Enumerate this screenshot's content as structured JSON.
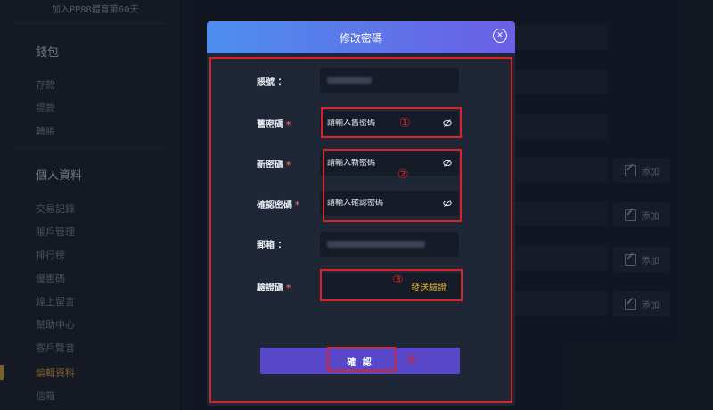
{
  "sidebar": {
    "top_text": "加入PP88體育第60天",
    "wallet_heading": "錢包",
    "wallet_items": [
      "存款",
      "提款",
      "轉賬"
    ],
    "profile_heading": "個人資料",
    "profile_items": [
      "交易記錄",
      "賬戶管理",
      "排行榜",
      "優惠碼",
      "線上留言",
      "幫助中心",
      "客戶聲音",
      "編輯資料",
      "信箱"
    ],
    "active_item": "編輯資料"
  },
  "background": {
    "add_label": "添加"
  },
  "modal": {
    "title": "修改密碼",
    "close_icon": "close-circle-icon",
    "account_label": "賬號 ：",
    "old_password_label": "舊密碼",
    "old_password_placeholder": "請輸入舊密碼",
    "new_password_label": "新密碼",
    "new_password_placeholder": "請輸入新密碼",
    "confirm_password_label": "確認密碼",
    "confirm_password_placeholder": "請輸入確認密碼",
    "email_label": "郵箱 ：",
    "code_label": "驗證碼",
    "send_code_label": "發送驗證",
    "confirm_button": "確 認",
    "required_mark": "*",
    "eye_icon": "eye-off-icon"
  },
  "annotations": {
    "n1": "①",
    "n2": "②",
    "n3": "③",
    "n4": "④",
    "color": "#d6242b"
  }
}
